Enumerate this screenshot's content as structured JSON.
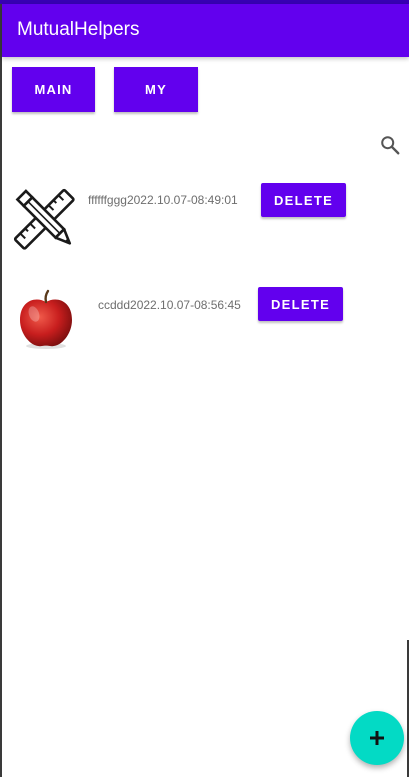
{
  "app": {
    "title": "MutualHelpers"
  },
  "tabs": {
    "main_label": "MAIN",
    "my_label": "MY"
  },
  "icons": {
    "search": "search-icon",
    "add": "add-icon",
    "item1": "ruler-pencil-icon",
    "item2": "apple-icon"
  },
  "items": [
    {
      "text": "ffffffggg2022.10.07-08:49:01",
      "delete_label": "DELETE"
    },
    {
      "text": "ccddd2022.10.07-08:56:45",
      "delete_label": "DELETE"
    }
  ],
  "colors": {
    "primary": "#6200ee",
    "accent": "#03dac5",
    "text_secondary": "#6e6e6e"
  }
}
